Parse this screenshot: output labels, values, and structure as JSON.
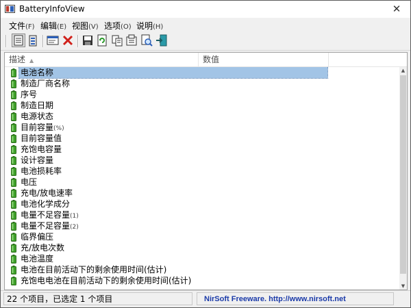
{
  "window": {
    "title": "BatteryInfoView",
    "close_glyph": "✕"
  },
  "menu": [
    {
      "label": "文件",
      "accel": "(F)"
    },
    {
      "label": "编辑",
      "accel": "(E)"
    },
    {
      "label": "视图",
      "accel": "(V)"
    },
    {
      "label": "选项",
      "accel": "(O)"
    },
    {
      "label": "说明",
      "accel": "(H)"
    }
  ],
  "toolbar": {
    "buttons": [
      "battery-info-mode-icon",
      "battery-log-mode-icon",
      "properties-window-icon",
      "delete-icon",
      "save-icon",
      "refresh-icon",
      "copy-icon",
      "properties-icon",
      "find-icon",
      "exit-icon"
    ]
  },
  "list": {
    "columns": [
      {
        "label": "描述",
        "sort_indicator": "▲"
      },
      {
        "label": "数值"
      }
    ],
    "rows": [
      {
        "label": "电池名称",
        "suffix": "",
        "selected": true
      },
      {
        "label": "制造厂商名称",
        "suffix": ""
      },
      {
        "label": "序号",
        "suffix": ""
      },
      {
        "label": "制造日期",
        "suffix": ""
      },
      {
        "label": "电源状态",
        "suffix": ""
      },
      {
        "label": "目前容量",
        "suffix": "(%)"
      },
      {
        "label": "目前容量值",
        "suffix": ""
      },
      {
        "label": "充饱电容量",
        "suffix": ""
      },
      {
        "label": "设计容量",
        "suffix": ""
      },
      {
        "label": "电池损耗率",
        "suffix": ""
      },
      {
        "label": "电压",
        "suffix": ""
      },
      {
        "label": "充电/放电速率",
        "suffix": ""
      },
      {
        "label": "电池化学成分",
        "suffix": ""
      },
      {
        "label": "电量不足容量",
        "suffix": "(1)"
      },
      {
        "label": "电量不足容量",
        "suffix": "(2)"
      },
      {
        "label": "临界偏压",
        "suffix": ""
      },
      {
        "label": "充/放电次数",
        "suffix": ""
      },
      {
        "label": "电池温度",
        "suffix": ""
      },
      {
        "label": "电池在目前活动下的剩余使用时间(估计)",
        "suffix": ""
      },
      {
        "label": "充饱电电池在目前活动下的剩余使用时间(估计)",
        "suffix": ""
      }
    ]
  },
  "status": {
    "items_text": "22 个项目，已选定 1 个项目",
    "credit": "NirSoft Freeware.  http://www.nirsoft.net"
  },
  "colors": {
    "selection": "#a2c4e6",
    "battery_green": "#3fa02a",
    "credit_link": "#1a3aa8"
  }
}
